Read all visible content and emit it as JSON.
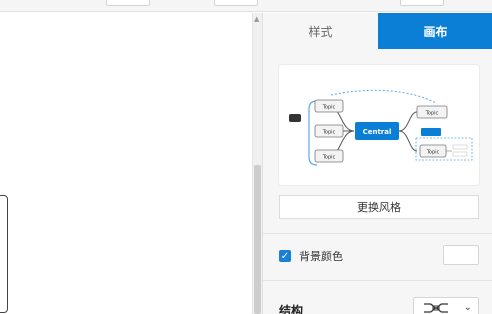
{
  "panel": {
    "tabs": [
      {
        "label": "样式",
        "active": false
      },
      {
        "label": "画布",
        "active": true
      }
    ],
    "preview": {
      "central": "Central",
      "topics": [
        "Topic",
        "Topic",
        "Topic",
        "Topic",
        "Topic"
      ]
    },
    "change_style_label": "更换风格",
    "background_color": {
      "label": "背景颜色",
      "checked": true,
      "value": "#ffffff"
    },
    "structure": {
      "label": "结构"
    }
  },
  "colors": {
    "accent": "#0b7fd6"
  }
}
